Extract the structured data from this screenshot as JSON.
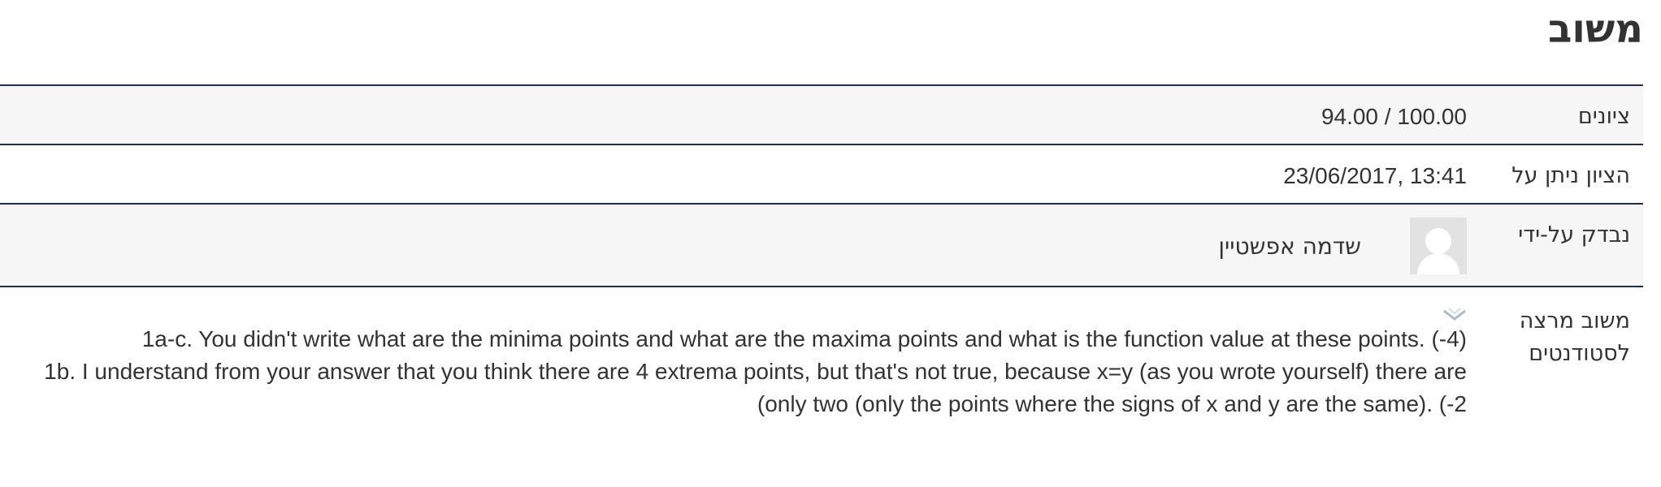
{
  "page_title": "משוב",
  "rows": {
    "grade": {
      "label": "ציונים",
      "value": "100.00 / 94.00"
    },
    "graded_on": {
      "label": "הציון ניתן על",
      "value": "13:41 ,23/06/2017"
    },
    "graded_by": {
      "label": "נבדק על-ידי",
      "grader_name": "שדמה אפשטיין",
      "avatar_icon": "default-user-avatar-icon"
    },
    "feedback_comments": {
      "label": "משוב מרצה לסטודנטים",
      "collapse_icon": "chevron-down-icon",
      "lines": [
        "(1a-c. You didn't write what are the minima points and what are the maxima points and what is the function value at these points. (-4",
        "1b. I understand from your answer that you think there are 4 extrema points, but that's not true, because x=y (as you wrote yourself) there are (only two (only the points where the signs of x and y are the same). (-2"
      ]
    }
  },
  "colors": {
    "row_border": "#1c2f4d",
    "shaded_row": "#f6f6f6",
    "text": "#333333",
    "avatar_bg": "#e2e2e2"
  }
}
